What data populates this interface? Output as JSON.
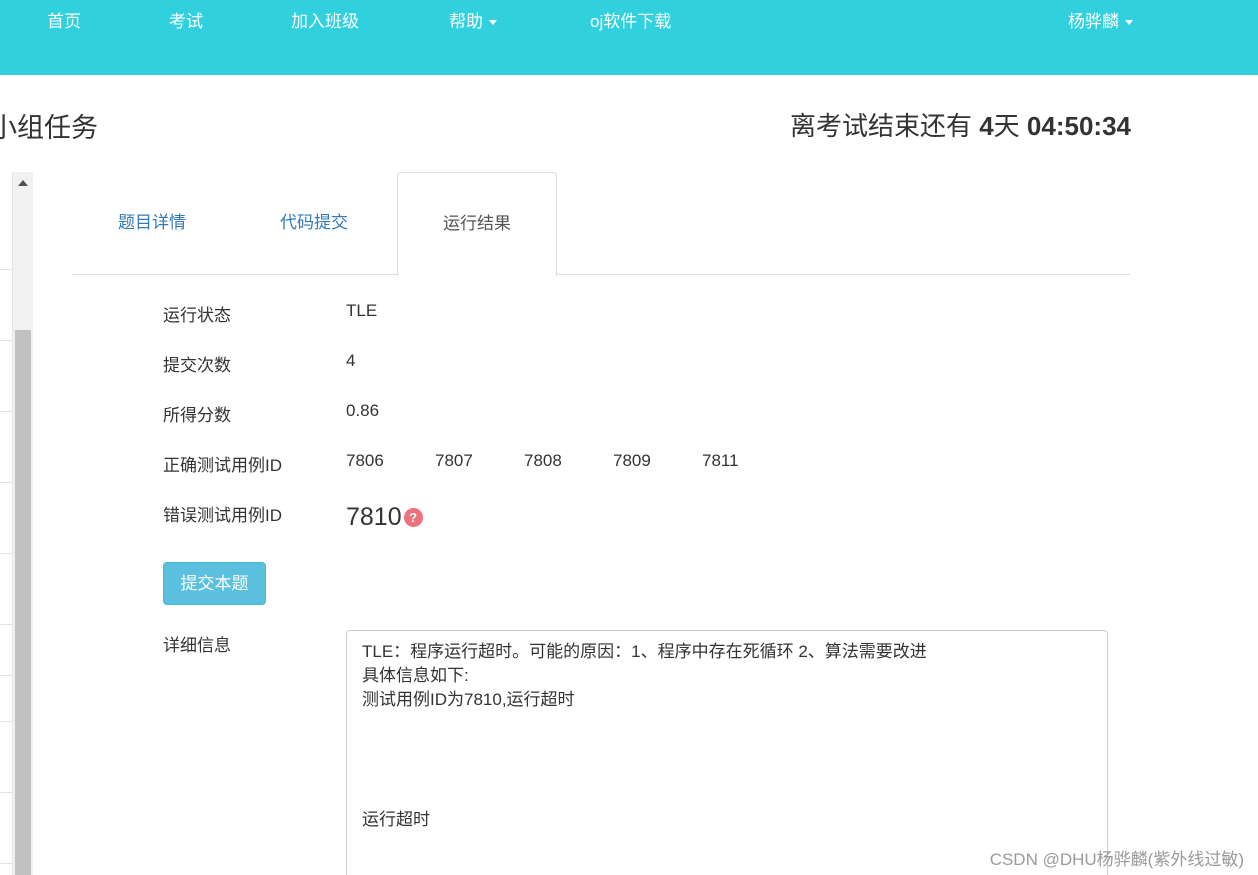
{
  "nav": {
    "home": "首页",
    "exam": "考试",
    "join_class": "加入班级",
    "help": "帮助",
    "download": "oj软件下载",
    "user": "杨骅麟"
  },
  "header": {
    "title": "小组任务",
    "countdown_prefix": "离考试结束还有",
    "days": "4",
    "days_unit": "天",
    "time": "04:50:34"
  },
  "tabs": [
    {
      "label": "题目详情"
    },
    {
      "label": "代码提交"
    },
    {
      "label": "运行结果"
    }
  ],
  "result": {
    "status_label": "运行状态",
    "status_value": "TLE",
    "submissions_label": "提交次数",
    "submissions_value": "4",
    "score_label": "所得分数",
    "score_value": "0.86",
    "correct_label": "正确测试用例ID",
    "correct_ids": [
      "7806",
      "7807",
      "7808",
      "7809",
      "7811"
    ],
    "wrong_label": "错误测试用例ID",
    "wrong_id": "7810",
    "help_glyph": "?",
    "submit_button": "提交本题",
    "detail_label": "详细信息",
    "detail_lines": [
      "TLE：程序运行超时。可能的原因：1、程序中存在死循环 2、算法需要改进",
      "具体信息如下:",
      "测试用例ID为7810,运行超时",
      "",
      "",
      "",
      "",
      "运行超时"
    ]
  },
  "watermark": "CSDN @DHU杨骅麟(紫外线过敏)",
  "colors": {
    "navbar": "#31d0de",
    "link": "#337ab7",
    "button": "#5bc0de",
    "help_icon": "#f0717e"
  }
}
